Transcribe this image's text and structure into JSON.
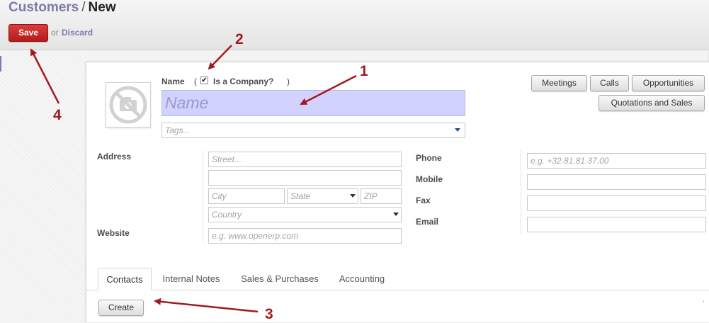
{
  "breadcrumb": {
    "parent": "Customers",
    "separator": "/",
    "current": "New"
  },
  "toolbar": {
    "save_label": "Save",
    "or_text": "or",
    "discard_label": "Discard"
  },
  "form": {
    "name_label": "Name",
    "paren_open": "(",
    "paren_close": ")",
    "is_company_label": "Is a Company?",
    "is_company_checked": true,
    "name_placeholder": "Name",
    "tags_placeholder": "Tags...",
    "address_label": "Address",
    "street_placeholder": "Street...",
    "street2_value": "",
    "city_placeholder": "City",
    "state_placeholder": "State",
    "zip_placeholder": "ZIP",
    "country_placeholder": "Country",
    "website_label": "Website",
    "website_placeholder": "e.g. www.openerp.com",
    "phone_label": "Phone",
    "phone_placeholder": "e.g. +32.81.81.37.00",
    "mobile_label": "Mobile",
    "fax_label": "Fax",
    "email_label": "Email"
  },
  "smart_buttons": [
    "Meetings",
    "Calls",
    "Opportunities",
    "Quotations and Sales"
  ],
  "tabs": [
    {
      "label": "Contacts",
      "active": true
    },
    {
      "label": "Internal Notes",
      "active": false
    },
    {
      "label": "Sales & Purchases",
      "active": false
    },
    {
      "label": "Accounting",
      "active": false
    }
  ],
  "contacts": {
    "create_label": "Create",
    "dot": "."
  },
  "annotations": [
    "1",
    "2",
    "3",
    "4"
  ],
  "colors": {
    "accent": "#7c7bad",
    "save": "#c62828",
    "annotation": "#a21a1f",
    "name_field_bg": "#d2d2ff"
  },
  "icons": {
    "avatar": "no-photo-camera-icon",
    "dropdown": "triangle-down-icon",
    "checkbox": "checkmark-icon"
  }
}
